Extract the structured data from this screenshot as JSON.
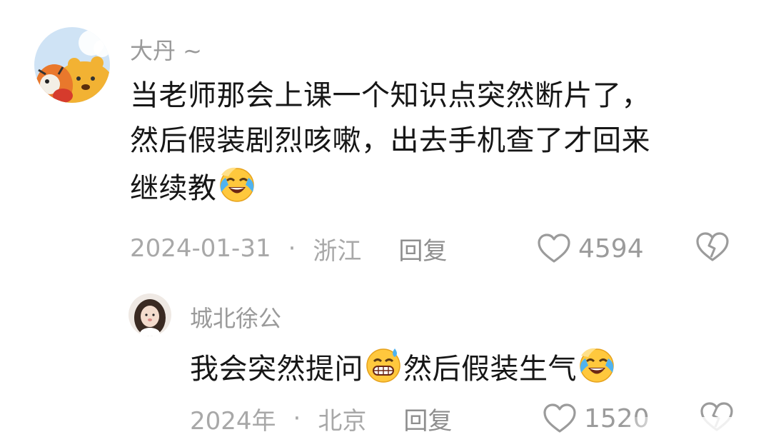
{
  "comments": [
    {
      "username": "大丹 ~",
      "text_lines": [
        "当老师那会上课一个知识点突然断片了，",
        "然后假装剧烈咳嗽，出去手机查了才回来",
        "继续教"
      ],
      "emoji": "laughing-tears-emoji",
      "date": "2024-01-31",
      "separator": "·",
      "location": "浙江",
      "reply_label": "回复",
      "like_count": "4594"
    },
    {
      "username": "城北徐公",
      "text_before": "我会突然提问",
      "emoji_1": "grin-sweat-emoji",
      "text_after": "然后假装生气",
      "emoji_2": "laughing-tears-emoji",
      "date": "2024年",
      "separator": "·",
      "location": "北京",
      "reply_label": "回复",
      "like_count": "1520"
    }
  ],
  "icons": {
    "like": "heart-outline-icon",
    "dislike": "broken-heart-icon"
  },
  "colors": {
    "username": "#9a9a9a",
    "body_text": "#161616",
    "meta_text": "#a8a8a8",
    "icon_stroke": "#9b9b9b",
    "emoji_yellow": "#ffc83d"
  }
}
